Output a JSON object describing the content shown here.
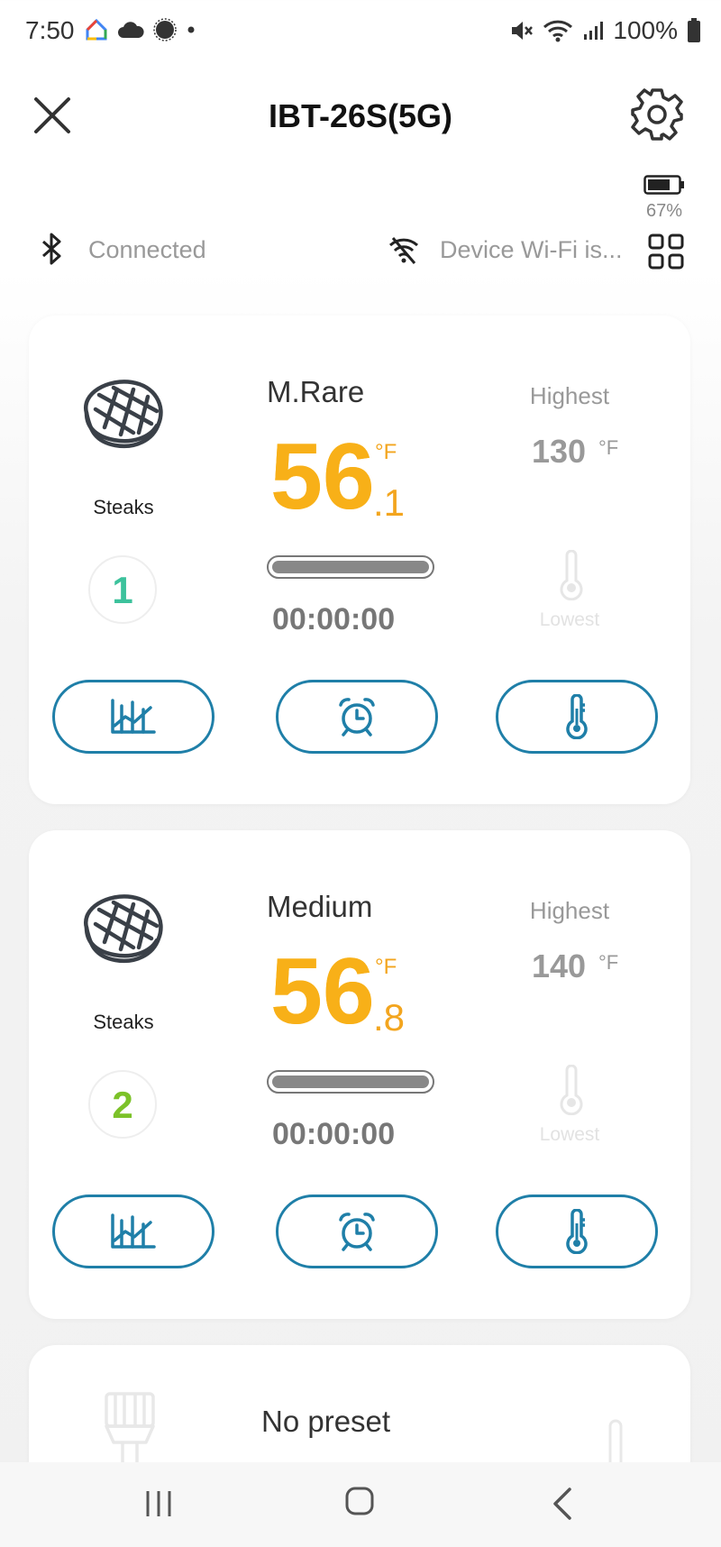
{
  "status_bar": {
    "time": "7:50",
    "battery_percent": "100%"
  },
  "header": {
    "title": "IBT-26S(5G)"
  },
  "device": {
    "battery_percent": "67%",
    "bluetooth_status": "Connected",
    "wifi_status": "Device Wi-Fi is..."
  },
  "probes": [
    {
      "number": "1",
      "number_color": "#3cc29c",
      "meat": "Steaks",
      "doneness": "M.Rare",
      "temp_int": "56",
      "temp_dec": ".1",
      "temp_unit": "°F",
      "progress": 1.0,
      "timer": "00:00:00",
      "highest_label": "Highest",
      "highest_value": "130",
      "highest_unit": "°F",
      "lowest_label": "Lowest"
    },
    {
      "number": "2",
      "number_color": "#7cc229",
      "meat": "Steaks",
      "doneness": "Medium",
      "temp_int": "56",
      "temp_dec": ".8",
      "temp_unit": "°F",
      "progress": 1.0,
      "timer": "00:00:00",
      "highest_label": "Highest",
      "highest_value": "140",
      "highest_unit": "°F",
      "lowest_label": "Lowest"
    },
    {
      "preset": "No preset"
    }
  ],
  "colors": {
    "accent": "#1f7fa8",
    "temperature": "#f8b018"
  },
  "icons": {
    "close": "close-icon",
    "settings": "gear-icon",
    "bluetooth": "bluetooth-icon",
    "wifi": "wifi-off-icon",
    "grid": "grid-icon",
    "meat": "steak-icon",
    "graph": "chart-icon",
    "alarm": "alarm-clock-icon",
    "thermometer": "thermometer-icon"
  }
}
